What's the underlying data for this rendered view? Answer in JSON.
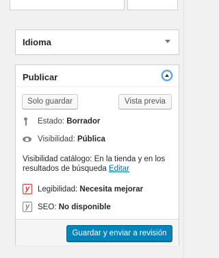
{
  "idioma_box": {
    "title": "Idioma"
  },
  "publish_box": {
    "title": "Publicar",
    "save_draft_label": "Solo guardar",
    "preview_label": "Vista previa",
    "status_label": "Estado:",
    "status_value": "Borrador",
    "visibility_label": "Visibilidad:",
    "visibility_value": "Pública",
    "catalog_visibility_text": "Visibilidad catálogo: En la tienda y en los resultados de búsqueda",
    "catalog_edit_link": "Editar",
    "readability_label": "Legibilidad:",
    "readability_value": "Necesita mejorar",
    "seo_label": "SEO:",
    "seo_value": "No disponible",
    "submit_label": "Guardar y enviar a revisión"
  },
  "icons": {
    "status": "pin-icon",
    "visibility": "eye-icon",
    "readability": "yoast-red-icon",
    "seo": "yoast-gray-icon",
    "toggle": "chevron-up-icon"
  },
  "colors": {
    "primary": "#0085ba",
    "link": "#0073aa",
    "readability_status": "#dc3232",
    "neutral_icon": "#82878c"
  }
}
